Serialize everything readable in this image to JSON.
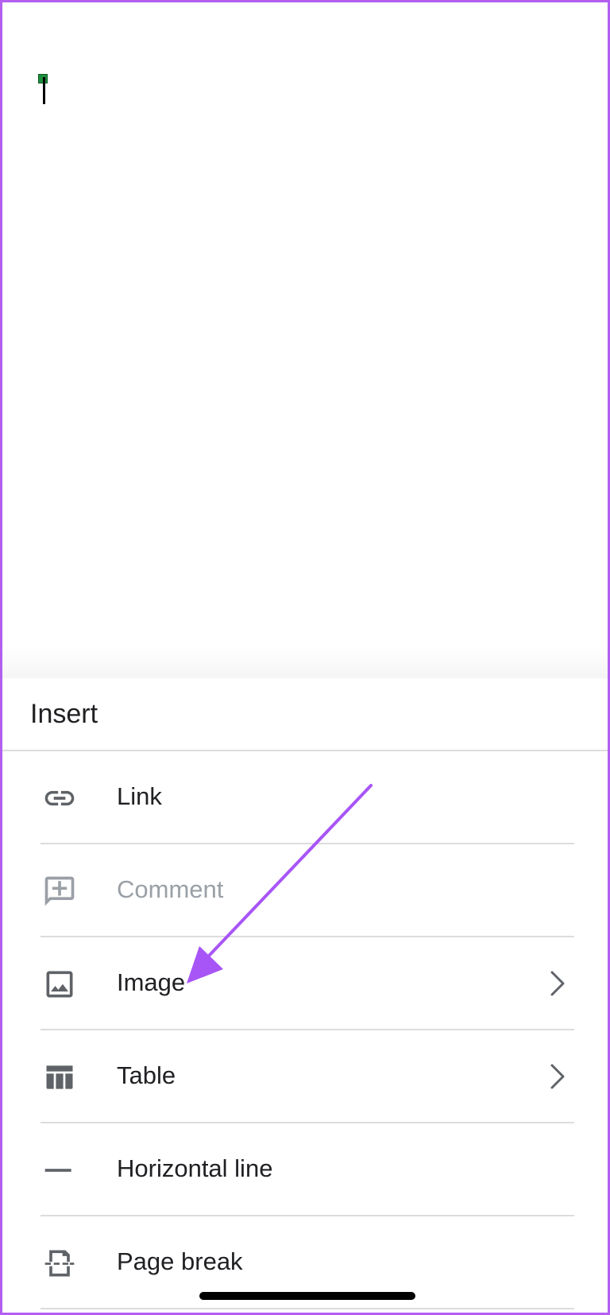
{
  "sheet": {
    "title": "Insert"
  },
  "menu": {
    "items": [
      {
        "label": "Link",
        "icon": "link-icon",
        "enabled": true,
        "has_submenu": false
      },
      {
        "label": "Comment",
        "icon": "add-comment-icon",
        "enabled": false,
        "has_submenu": false
      },
      {
        "label": "Image",
        "icon": "image-icon",
        "enabled": true,
        "has_submenu": true
      },
      {
        "label": "Table",
        "icon": "table-icon",
        "enabled": true,
        "has_submenu": true
      },
      {
        "label": "Horizontal line",
        "icon": "horizontal-line-icon",
        "enabled": true,
        "has_submenu": false
      },
      {
        "label": "Page break",
        "icon": "page-break-icon",
        "enabled": true,
        "has_submenu": false
      }
    ]
  },
  "colors": {
    "frame_border": "#b25ff0",
    "annotation_arrow": "#a855f7",
    "icon": "#5f6368",
    "text": "#202124",
    "disabled_text": "#9aa0a6",
    "cursor_handle": "#1e8e3e"
  }
}
